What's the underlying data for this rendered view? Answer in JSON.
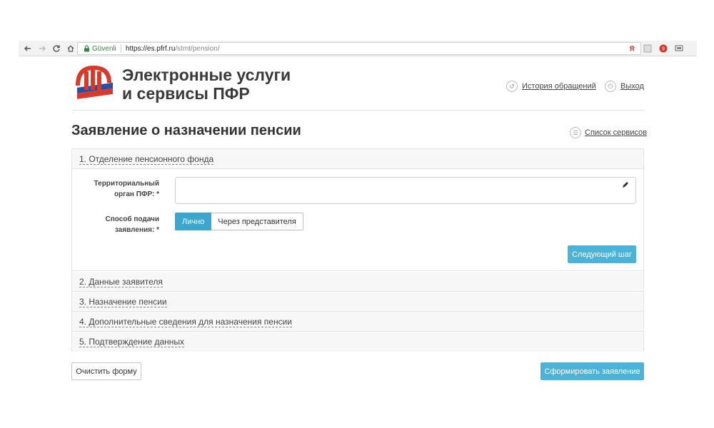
{
  "browser": {
    "back_icon": "arrow-left-icon",
    "forward_icon": "arrow-right-icon",
    "reload_icon": "reload-icon",
    "home_icon": "home-icon",
    "secure_label": "Güvenli",
    "url_host": "https://es.pfrf.ru",
    "url_path": "/stmt/pension/",
    "bookmark_icon": "star-icon"
  },
  "header": {
    "title_line1": "Электронные услуги",
    "title_line2": "и сервисы ПФР",
    "history_label": "История обращений",
    "logout_label": "Выход"
  },
  "page": {
    "title": "Заявление о назначении пенсии",
    "services_label": "Список сервисов"
  },
  "steps": [
    {
      "label": "1. Отделение пенсионного фонда"
    },
    {
      "label": "2. Данные заявителя"
    },
    {
      "label": "3. Назначение пенсии"
    },
    {
      "label": "4. Дополнительные сведения для назначения пенсии"
    },
    {
      "label": "5. Подтверждение данных"
    }
  ],
  "form": {
    "territorial_label_line1": "Территориальный",
    "territorial_label_line2": "орган ПФР:",
    "territorial_value": "",
    "method_label_line1": "Способ подачи",
    "method_label_line2": "заявления:",
    "required_mark": "*",
    "method_options": [
      "Лично",
      "Через представителя"
    ],
    "method_selected": "Лично",
    "next_step_label": "Следующий шаг"
  },
  "actions": {
    "clear_label": "Очистить форму",
    "submit_label": "Сформировать заявление"
  },
  "colors": {
    "accent": "#4bb3d8",
    "logo_red": "#d63a2a",
    "logo_blue": "#2b4fa3",
    "secure_green": "#2e8b3d"
  }
}
